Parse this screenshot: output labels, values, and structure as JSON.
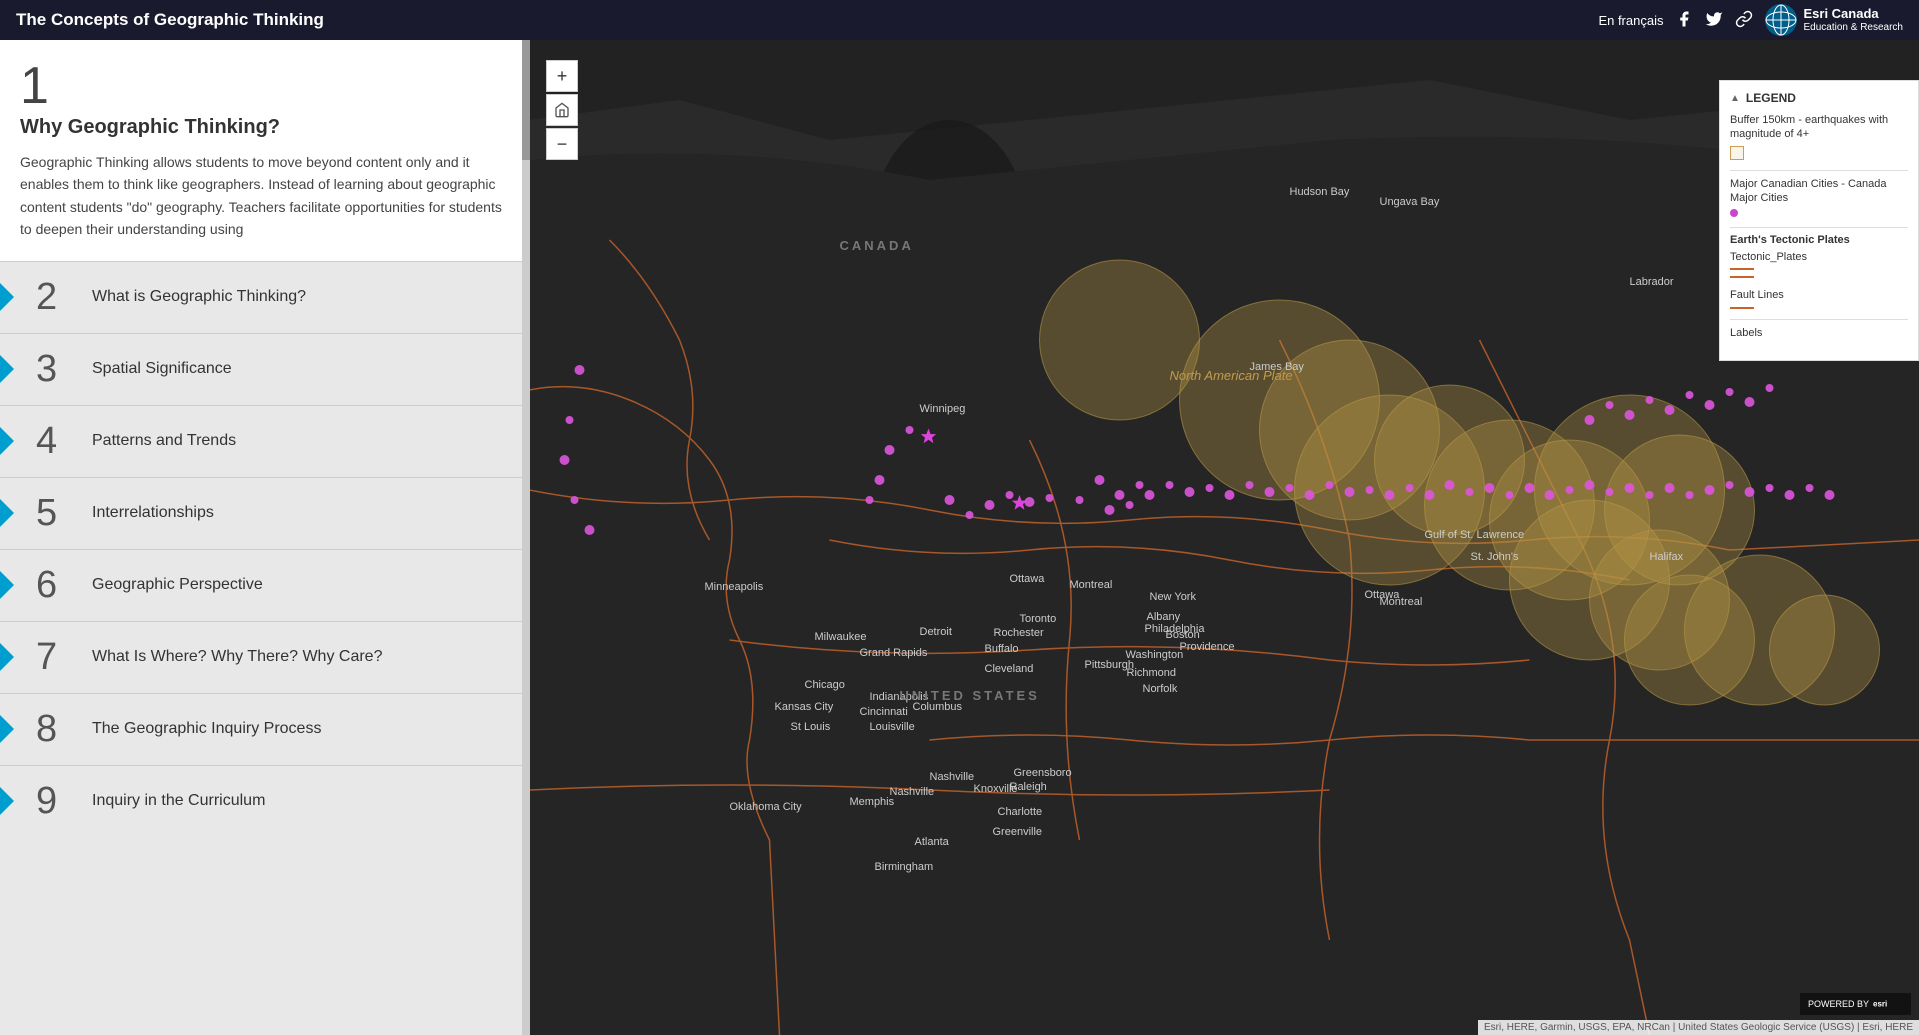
{
  "header": {
    "title": "The Concepts of Geographic Thinking",
    "language_link": "En français",
    "icons": [
      "facebook-icon",
      "twitter-icon",
      "link-icon"
    ],
    "esri_label": "Esri Canada",
    "esri_sub": "Education & Research"
  },
  "sidebar": {
    "active_item": {
      "number": "1",
      "title": "Why Geographic Thinking?",
      "description": "Geographic Thinking allows students to move beyond content only and it enables them to think like geographers. Instead of learning about geographic content students \"do\" geography. Teachers facilitate opportunities for students to deepen their understanding using"
    },
    "nav_items": [
      {
        "number": "2",
        "label": "What is Geographic Thinking?"
      },
      {
        "number": "3",
        "label": "Spatial Significance"
      },
      {
        "number": "4",
        "label": "Patterns and Trends"
      },
      {
        "number": "5",
        "label": "Interrelationships"
      },
      {
        "number": "6",
        "label": "Geographic Perspective"
      },
      {
        "number": "7",
        "label": "What Is Where? Why There? Why Care?"
      },
      {
        "number": "8",
        "label": "The Geographic Inquiry Process"
      },
      {
        "number": "9",
        "label": "Inquiry in the Curriculum"
      }
    ]
  },
  "legend": {
    "title": "LEGEND",
    "items": [
      {
        "id": "buffer",
        "label": "Buffer 150km - earthquakes with magnitude of 4+",
        "symbol": "square"
      },
      {
        "id": "cities",
        "label": "Major Canadian Cities - Canada Major Cities",
        "symbol": "dot"
      },
      {
        "id": "tectonic",
        "section_title": "Earth's Tectonic Plates",
        "label": "Tectonic_Plates",
        "symbol": "double-line"
      },
      {
        "id": "fault",
        "label": "Fault Lines",
        "symbol": "single-line"
      },
      {
        "id": "labels",
        "label": "Labels",
        "symbol": "none"
      }
    ]
  },
  "map": {
    "attribution": "Esri, HERE, Garmin, USGS, EPA, NRCan | United States Geologic Service (USGS) | Esri, HERE"
  }
}
